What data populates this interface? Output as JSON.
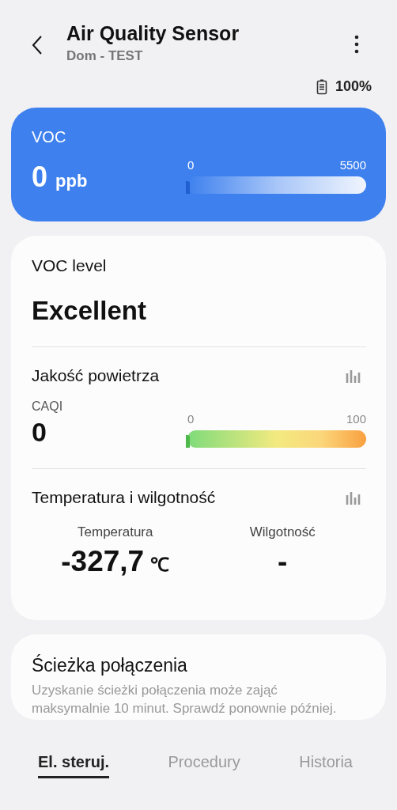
{
  "header": {
    "title": "Air Quality Sensor",
    "subtitle": "Dom - TEST",
    "battery": "100%"
  },
  "voc_card": {
    "label": "VOC",
    "value": "0",
    "unit": "ppb",
    "gauge": {
      "min": "0",
      "max": "5500",
      "level": 0
    }
  },
  "voc_level": {
    "label": "VOC level",
    "value": "Excellent"
  },
  "air_quality": {
    "title": "Jakość powietrza",
    "index_label": "CAQI",
    "value": "0",
    "gauge": {
      "min": "0",
      "max": "100",
      "level": 0
    }
  },
  "climate": {
    "title": "Temperatura i wilgotność",
    "readings": [
      {
        "label": "Temperatura",
        "value": "-327,7",
        "unit": "℃"
      },
      {
        "label": "Wilgotność",
        "value": "-"
      }
    ]
  },
  "connection": {
    "title": "Ścieżka połączenia",
    "text": "Uzyskanie ścieżki połączenia może zająć maksymalnie 10 minut. Sprawdź ponownie później."
  },
  "tabs": [
    {
      "label": "El. steruj.",
      "selected": true
    },
    {
      "label": "Procedury",
      "selected": false
    },
    {
      "label": "Historia",
      "selected": false
    }
  ]
}
